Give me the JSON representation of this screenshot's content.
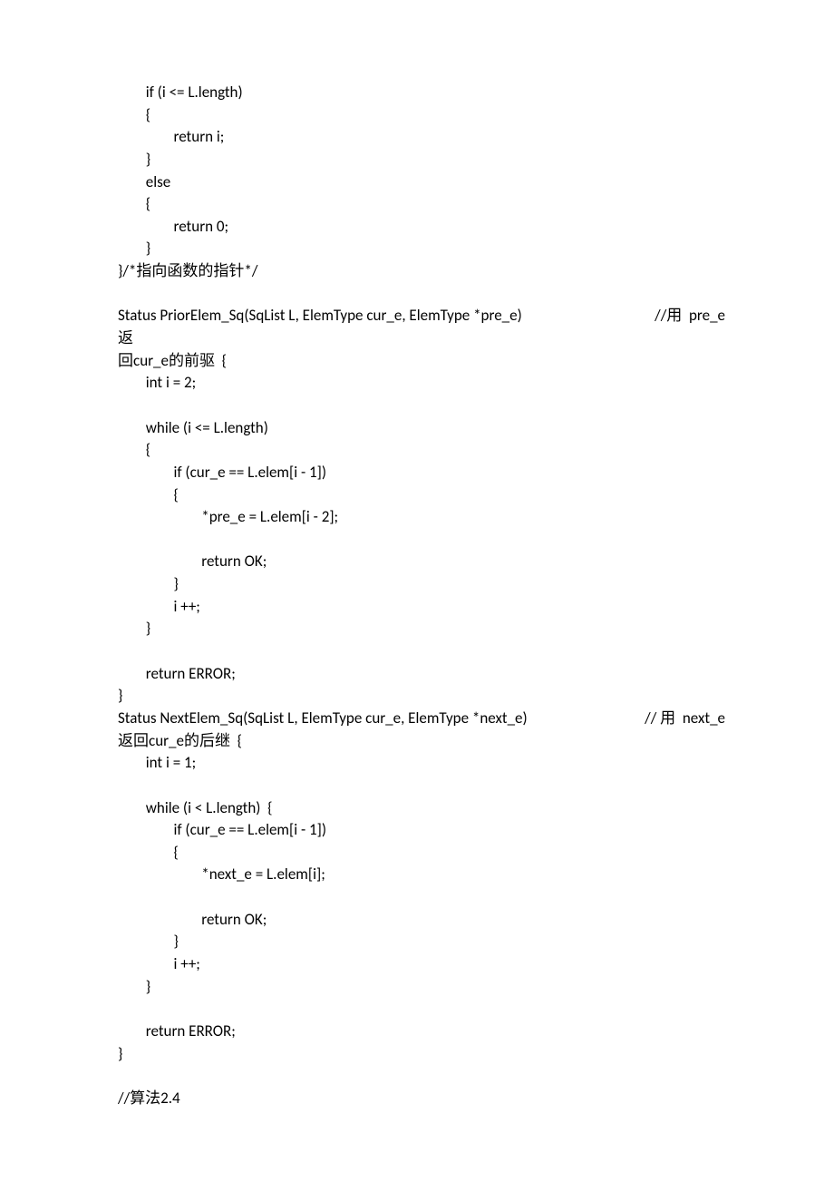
{
  "code1": "        if (i <= L.length)\n        {\n                return i;\n        }\n        else\n        {\n                return 0;\n        }\n}/*指向函数的指针*/",
  "sig1_left": "Status PriorElem_Sq(SqList L, ElemType cur_e, ElemType *pre_e)",
  "sig1_right": "//用  pre_e",
  "sig1_tail": "返",
  "code2": "回cur_e的前驱  {\n        int i = 2;\n\n        while (i <= L.length)\n        {\n                if (cur_e == L.elem[i - 1])\n                {\n                        *pre_e = L.elem[i - 2];\n\n                        return OK;\n                }\n                i ++;\n        }\n\n        return ERROR;\n}",
  "sig2_left": "Status NextElem_Sq(SqList L, ElemType cur_e, ElemType *next_e)",
  "sig2_right": "// 用  next_e",
  "code3": "返回cur_e的后继  {\n        int i = 1;\n\n        while (i < L.length)  {\n                if (cur_e == L.elem[i - 1])\n                {\n                        *next_e = L.elem[i];\n\n                        return OK;\n                }\n                i ++;\n        }\n\n        return ERROR;\n}\n\n//算法2.4"
}
